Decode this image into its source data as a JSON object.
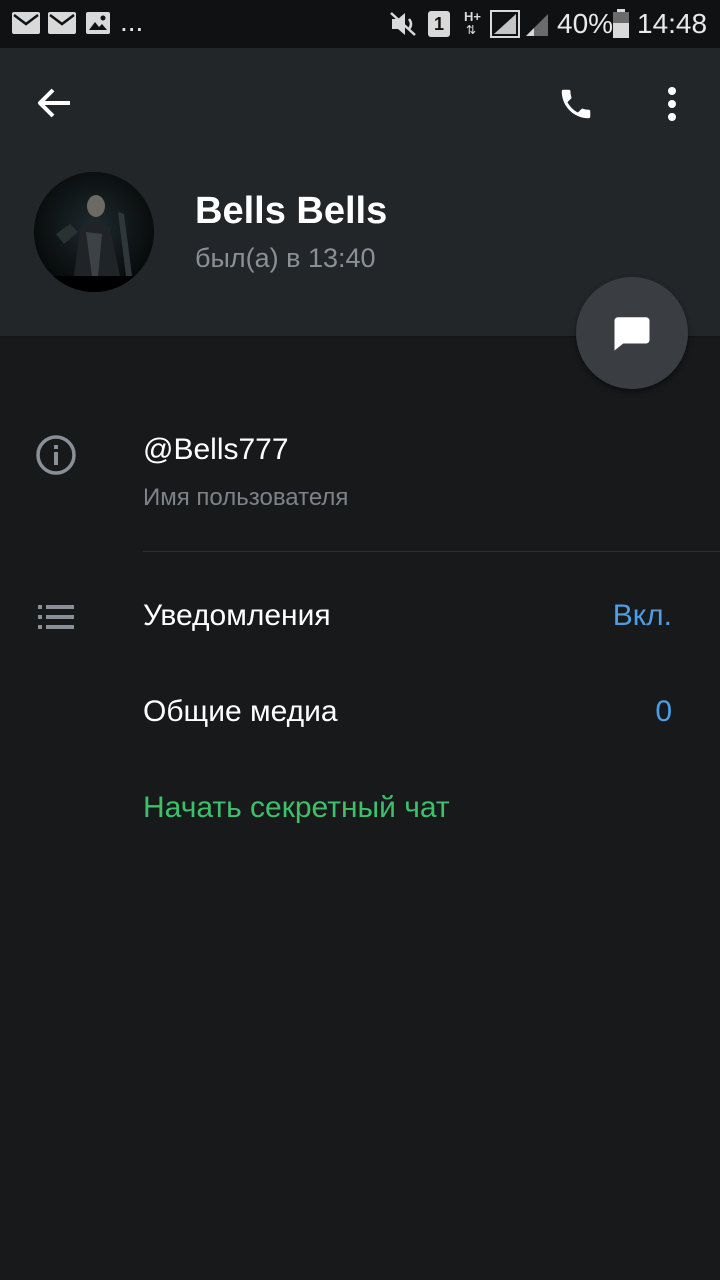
{
  "status_bar": {
    "overflow": "...",
    "sim_badge": "1",
    "network_type": "H+",
    "battery_percent": "40%",
    "time": "14:48",
    "icons": [
      "mail-icon",
      "mail-icon",
      "image-icon",
      "mute-icon",
      "sim-icon",
      "network-icon",
      "signal-icon",
      "signal-icon",
      "battery-icon"
    ]
  },
  "toolbar": {
    "icons": [
      "back-arrow-icon",
      "phone-icon",
      "more-vert-icon"
    ]
  },
  "profile": {
    "name": "Bells Bells",
    "last_seen": "был(а) в 13:40"
  },
  "info": {
    "username": "@Bells777",
    "username_caption": "Имя пользователя",
    "notifications_label": "Уведомления",
    "notifications_value": "Вкл.",
    "shared_media_label": "Общие медиа",
    "shared_media_count": "0",
    "secret_chat_label": "Начать секретный чат"
  },
  "colors": {
    "accent_blue": "#4a9fe6",
    "secret_green": "#3cc16a",
    "header_bg": "#232629",
    "body_bg": "#18191b"
  }
}
